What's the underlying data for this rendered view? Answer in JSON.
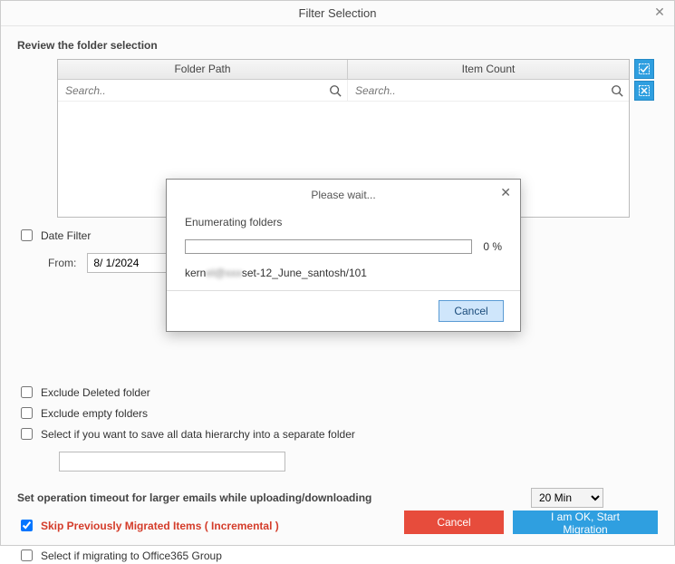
{
  "window": {
    "title": "Filter Selection"
  },
  "review": {
    "heading": "Review the folder selection",
    "columns": {
      "path": "Folder Path",
      "count": "Item Count"
    },
    "search_placeholder": "Search.."
  },
  "date_filter": {
    "label": "Date Filter",
    "from_label": "From:",
    "from_value": "8/ 1/2024"
  },
  "options": {
    "exclude_deleted": "Exclude Deleted folder",
    "exclude_empty": "Exclude empty folders",
    "save_hierarchy": "Select if you want to save all data hierarchy into a separate folder",
    "hierarchy_path": ""
  },
  "timeout": {
    "label": "Set operation timeout for larger emails while uploading/downloading",
    "selected": "20 Min"
  },
  "skip": {
    "label": "Skip Previously Migrated Items ( Incremental )",
    "checked": true
  },
  "office365": {
    "label": "Select if migrating to Office365 Group"
  },
  "footer": {
    "cancel": "Cancel",
    "start": "I am OK, Start Migration"
  },
  "modal": {
    "title": "Please wait...",
    "status": "Enumerating folders",
    "percent": "0 %",
    "path_prefix": "kern",
    "path_mid": "el@xxx",
    "path_suffix": "set-12_June_santosh/101",
    "cancel": "Cancel"
  }
}
